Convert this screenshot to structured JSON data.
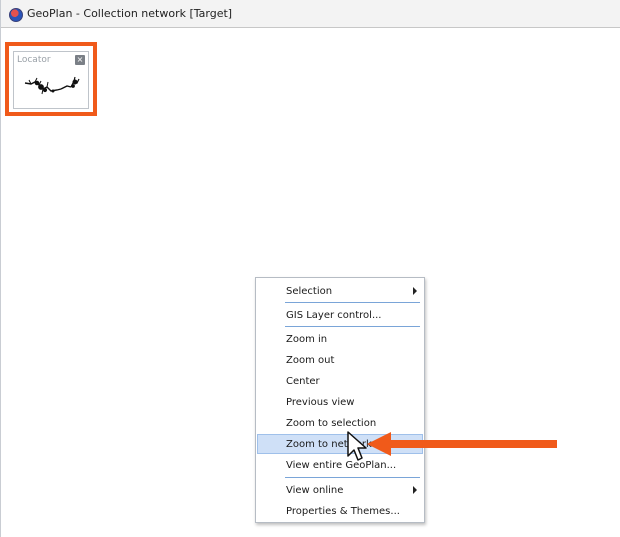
{
  "window": {
    "title": "GeoPlan - Collection network [Target]"
  },
  "locator": {
    "title": "Locator",
    "close_glyph": "×"
  },
  "context_menu": {
    "items": [
      {
        "label": "Selection",
        "submenu": true
      },
      {
        "label": "GIS Layer control...",
        "submenu": false
      },
      {
        "label": "Zoom in",
        "submenu": false
      },
      {
        "label": "Zoom out",
        "submenu": false
      },
      {
        "label": "Center",
        "submenu": false
      },
      {
        "label": "Previous view",
        "submenu": false
      },
      {
        "label": "Zoom to selection",
        "submenu": false
      },
      {
        "label": "Zoom to network",
        "submenu": false,
        "highlighted": true
      },
      {
        "label": "View entire GeoPlan...",
        "submenu": false
      },
      {
        "label": "View online",
        "submenu": true
      },
      {
        "label": "Properties & Themes...",
        "submenu": false
      }
    ]
  },
  "annotation": {
    "highlight_color": "#f05a1a",
    "arrow_color": "#f05a1a"
  },
  "icons": {
    "app": "geoplan-app-icon",
    "cursor": "mouse-pointer-icon"
  }
}
